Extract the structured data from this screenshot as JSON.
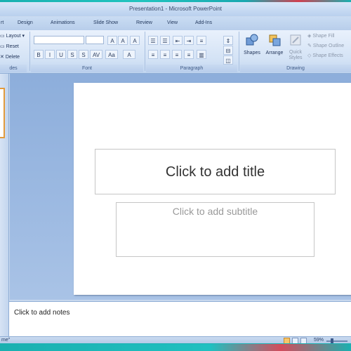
{
  "window": {
    "title": "Presentation1 - Microsoft PowerPoint"
  },
  "tabs": [
    "rt",
    "Design",
    "Animations",
    "Slide Show",
    "Review",
    "View",
    "Add-Ins"
  ],
  "ribbon": {
    "slides_group": {
      "layout": "Layout",
      "reset": "Reset",
      "delete": "Delete",
      "label": "des"
    },
    "font_group": {
      "label": "Font",
      "grow": "A",
      "shrink": "A",
      "clear": "A",
      "bold": "B",
      "italic": "I",
      "underline": "U",
      "strike": "S",
      "shadow": "S",
      "spacing": "AV",
      "case": "Aa",
      "color": "A"
    },
    "paragraph_group": {
      "label": "Paragraph"
    },
    "drawing_group": {
      "label": "Drawing",
      "shapes": "Shapes",
      "arrange": "Arrange",
      "quick_styles": "Quick Styles",
      "shape_fill": "Shape Fill",
      "shape_outline": "Shape Outline",
      "shape_effects": "Shape Effects"
    }
  },
  "slide": {
    "title_placeholder": "Click to add title",
    "subtitle_placeholder": "Click to add subtitle"
  },
  "notes": {
    "placeholder": "Click to add notes"
  },
  "status": {
    "left": "me\"",
    "zoom": "59%"
  },
  "zoom_level": 0.59,
  "colors": {
    "accent": "#e29b3d",
    "ribbon": "#d3e2f5",
    "slide_bg": "#a9c3e6"
  }
}
